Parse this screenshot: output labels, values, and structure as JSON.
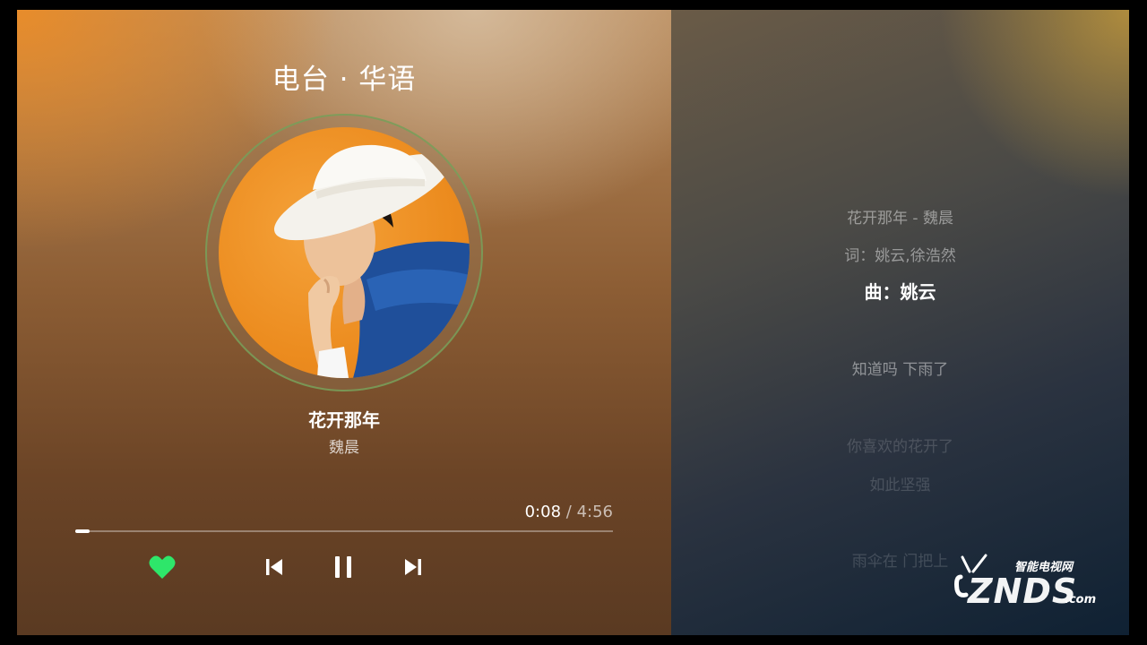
{
  "header": {
    "station": "电台 · 华语"
  },
  "now_playing": {
    "title": "花开那年",
    "artist": "魏晨",
    "elapsed": "0:08",
    "separator": "/",
    "duration": "4:56",
    "progress": 0.027
  },
  "controls": {
    "like_icon": "heart-icon",
    "prev_icon": "skip-previous-icon",
    "pause_icon": "pause-icon",
    "next_icon": "skip-next-icon",
    "like_color": "#2ee66a"
  },
  "lyrics": [
    {
      "text": "花开那年 - 魏晨",
      "state": "faded"
    },
    {
      "text": "词：姚云,徐浩然",
      "state": "faded"
    },
    {
      "text": "曲：姚云",
      "state": "current"
    },
    {
      "text": "知道吗 下雨了",
      "state": "faded"
    },
    {
      "text": "你喜欢的花开了",
      "state": "dim"
    },
    {
      "text": "如此坚强",
      "state": "dim"
    },
    {
      "text": "雨伞在 门把上",
      "state": "dim"
    }
  ],
  "watermark": {
    "top": "智能电视网",
    "main": "ZNDS",
    "suffix": ".com"
  }
}
